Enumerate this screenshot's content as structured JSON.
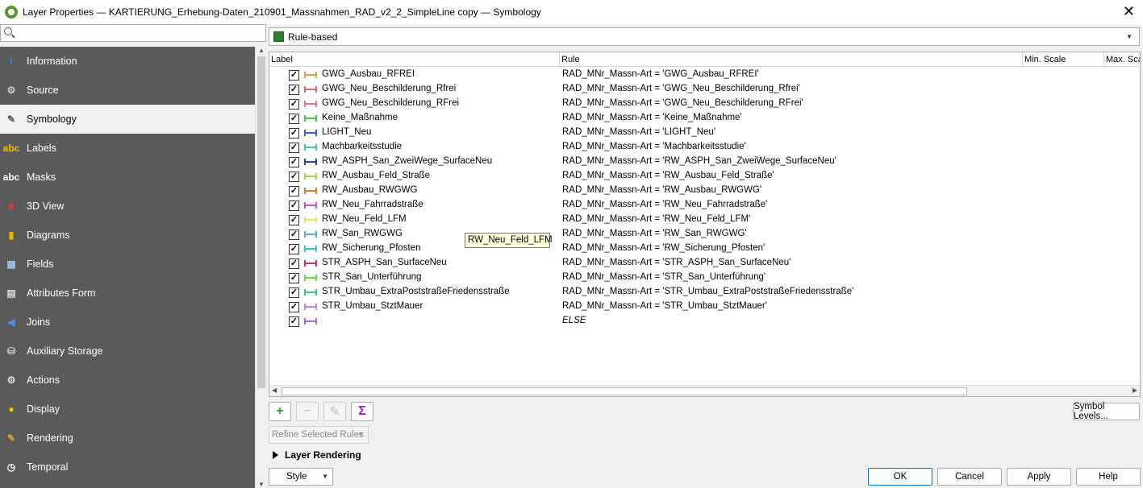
{
  "window": {
    "title": "Layer Properties — KARTIERUNG_Erhebung-Daten_210901_Massnahmen_RAD_v2_2_SimpleLine copy — Symbology",
    "close": "✕"
  },
  "search": {
    "placeholder": ""
  },
  "nav": [
    {
      "name": "information",
      "label": "Information",
      "icon": "info-icon",
      "glyph": "i",
      "color": "#3a7bd5",
      "active": false
    },
    {
      "name": "source",
      "label": "Source",
      "icon": "wrench-icon",
      "glyph": "⚙",
      "color": "#cccccc",
      "active": false
    },
    {
      "name": "symbology",
      "label": "Symbology",
      "icon": "paintbrush-icon",
      "glyph": "✎",
      "color": "#555555",
      "active": true
    },
    {
      "name": "labels",
      "label": "Labels",
      "icon": "abc-label-icon",
      "glyph": "abc",
      "color": "#f2c200",
      "active": false
    },
    {
      "name": "masks",
      "label": "Masks",
      "icon": "abc-mask-icon",
      "glyph": "abc",
      "color": "#ffffff",
      "active": false
    },
    {
      "name": "3d-view",
      "label": "3D View",
      "icon": "cube-icon",
      "glyph": "■",
      "color": "#e53935",
      "active": false
    },
    {
      "name": "diagrams",
      "label": "Diagrams",
      "icon": "bar-chart-icon",
      "glyph": "▮",
      "color": "#e8b800",
      "active": false
    },
    {
      "name": "fields",
      "label": "Fields",
      "icon": "table-icon",
      "glyph": "▦",
      "color": "#9fc3ea",
      "active": false
    },
    {
      "name": "attributes-form",
      "label": "Attributes Form",
      "icon": "form-icon",
      "glyph": "▤",
      "color": "#dddddd",
      "active": false
    },
    {
      "name": "joins",
      "label": "Joins",
      "icon": "join-icon",
      "glyph": "◀",
      "color": "#4a90d9",
      "active": false
    },
    {
      "name": "auxiliary-storage",
      "label": "Auxiliary Storage",
      "icon": "database-icon",
      "glyph": "⛁",
      "color": "#cccccc",
      "active": false
    },
    {
      "name": "actions",
      "label": "Actions",
      "icon": "gear-icon",
      "glyph": "⚙",
      "color": "#dddddd",
      "active": false
    },
    {
      "name": "display",
      "label": "Display",
      "icon": "speech-bubble-icon",
      "glyph": "●",
      "color": "#f2c200",
      "active": false
    },
    {
      "name": "rendering",
      "label": "Rendering",
      "icon": "brush-icon",
      "glyph": "✎",
      "color": "#d9a441",
      "active": false
    },
    {
      "name": "temporal",
      "label": "Temporal",
      "icon": "clock-icon",
      "glyph": "◷",
      "color": "#ffffff",
      "active": false
    }
  ],
  "renderer": {
    "value": "Rule-based"
  },
  "tree": {
    "headers": {
      "label": "Label",
      "rule": "Rule",
      "min_scale": "Min. Scale",
      "max_scale": "Max. Sca"
    },
    "rows": [
      {
        "label": "GWG_Ausbau_RFREI",
        "rule": "RAD_MNr_Massn-Art = 'GWG_Ausbau_RFREI'",
        "color": "#d9a441"
      },
      {
        "label": "GWG_Neu_Beschilderung_Rfrei",
        "rule": "RAD_MNr_Massn-Art = 'GWG_Neu_Beschilderung_Rfrei'",
        "color": "#d96a6a"
      },
      {
        "label": "GWG_Neu_Beschilderung_RFrei",
        "rule": "RAD_MNr_Massn-Art = 'GWG_Neu_Beschilderung_RFrei'",
        "color": "#d974a9"
      },
      {
        "label": "Keine_Maßnahme",
        "rule": "RAD_MNr_Massn-Art = 'Keine_Maßnahme'",
        "color": "#44c44a"
      },
      {
        "label": "LIGHT_Neu",
        "rule": "RAD_MNr_Massn-Art = 'LIGHT_Neu'",
        "color": "#3b5bd9"
      },
      {
        "label": "Machbarkeitsstudie",
        "rule": "RAD_MNr_Massn-Art = 'Machbarkeitsstudie'",
        "color": "#3cc8a0"
      },
      {
        "label": "RW_ASPH_San_ZweiWege_SurfaceNeu",
        "rule": "RAD_MNr_Massn-Art = 'RW_ASPH_San_ZweiWege_SurfaceNeu'",
        "color": "#2e3fb8"
      },
      {
        "label": "RW_Ausbau_Feld_Straße",
        "rule": "RAD_MNr_Massn-Art = 'RW_Ausbau_Feld_Straße'",
        "color": "#9ad94a"
      },
      {
        "label": "RW_Ausbau_RWGWG",
        "rule": "RAD_MNr_Massn-Art = 'RW_Ausbau_RWGWG'",
        "color": "#e07b1a"
      },
      {
        "label": "RW_Neu_Fahrradstraße",
        "rule": "RAD_MNr_Massn-Art = 'RW_Neu_Fahrradstraße'",
        "color": "#d64ed6"
      },
      {
        "label": "RW_Neu_Feld_LFM",
        "rule": "RAD_MNr_Massn-Art = 'RW_Neu_Feld_LFM'",
        "color": "#e8e070"
      },
      {
        "label": "RW_San_RWGWG",
        "rule": "RAD_MNr_Massn-Art = 'RW_San_RWGWG'",
        "color": "#5aa8d8"
      },
      {
        "label": "RW_Sicherung_Pfosten",
        "rule": "RAD_MNr_Massn-Art = 'RW_Sicherung_Pfosten'",
        "color": "#2fc8c8"
      },
      {
        "label": "STR_ASPH_San_SurfaceNeu",
        "rule": "RAD_MNr_Massn-Art = 'STR_ASPH_San_SurfaceNeu'",
        "color": "#d6304e"
      },
      {
        "label": "STR_San_Unterführung",
        "rule": "RAD_MNr_Massn-Art = 'STR_San_Unterführung'",
        "color": "#6fd64e"
      },
      {
        "label": "STR_Umbau_ExtraPoststraßeFriedensstraße",
        "rule": "RAD_MNr_Massn-Art = 'STR_Umbau_ExtraPoststraßeFriedensstraße'",
        "color": "#3cc872"
      },
      {
        "label": "STR_Umbau_StztMauer",
        "rule": "RAD_MNr_Massn-Art = 'STR_Umbau_StztMauer'",
        "color": "#b985d6"
      },
      {
        "label": "",
        "rule": "ELSE",
        "color": "#a86ad9",
        "italic": true
      }
    ],
    "check_glyph": "✓"
  },
  "tooltip": {
    "text": "RW_Neu_Feld_LFM"
  },
  "tools": {
    "add": "+",
    "remove": "−",
    "edit": "✎",
    "sum": "Σ"
  },
  "refine": {
    "label": "Refine Selected Rules"
  },
  "symbol_levels": {
    "label": "Symbol Levels..."
  },
  "layer_rendering": {
    "label": "Layer Rendering"
  },
  "footer": {
    "style": "Style",
    "ok": "OK",
    "cancel": "Cancel",
    "apply": "Apply",
    "help": "Help"
  }
}
